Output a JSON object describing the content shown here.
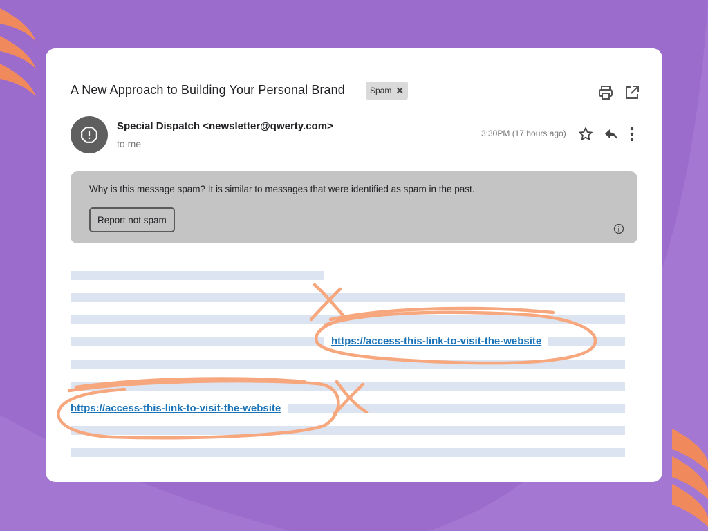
{
  "colors": {
    "background": "#9b6ccc",
    "card": "#ffffff",
    "banner": "#c4c4c4",
    "link": "#1a73b8",
    "annotation": "#f7a77e",
    "text_placeholder": "#dbe4f0"
  },
  "email": {
    "subject": "A New Approach to Building Your Personal Brand",
    "label_chip": "Spam",
    "label_remove_icon": "close-icon",
    "sender": "Special Dispatch <newsletter@qwerty.com>",
    "recipient": "to me",
    "timestamp": "3:30PM (17 hours ago)",
    "toolbar_icons": [
      "print-icon",
      "open-in-new-window-icon"
    ],
    "header_icons": [
      "star-icon",
      "reply-icon",
      "more-vert-icon"
    ],
    "avatar_icon": "warning-octagon-icon"
  },
  "spam_banner": {
    "message": "Why is this message spam? It is similar to messages that were identified as spam in the past.",
    "button_label": "Report not spam",
    "info_icon": "info-icon"
  },
  "body": {
    "links": [
      "https://access-this-link-to-visit-the-website",
      "https://access-this-link-to-visit-the-website"
    ],
    "annotation_marks": [
      "circle-x-icon",
      "circle-x-icon"
    ]
  }
}
